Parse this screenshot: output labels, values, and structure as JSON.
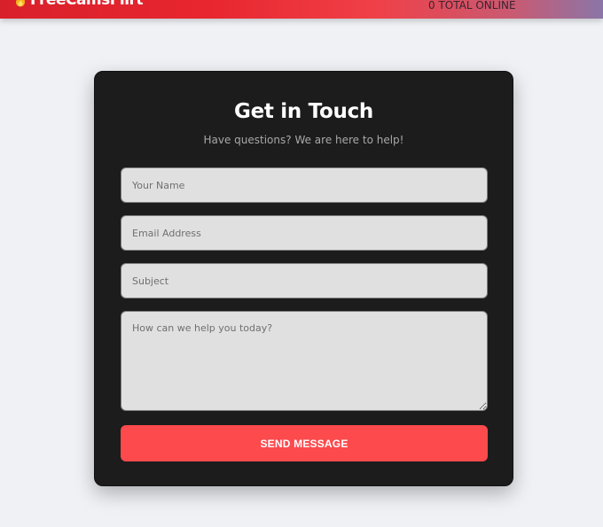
{
  "header": {
    "logo_text": "FreeCamsFlirt",
    "online_status": "0 TOTAL ONLINE",
    "logo_icon": "flame-icon"
  },
  "contact_form": {
    "title": "Get in Touch",
    "subtitle": "Have questions? We are here to help!",
    "name_placeholder": "Your Name",
    "name_value": "",
    "email_placeholder": "Email Address",
    "email_value": "",
    "subject_placeholder": "Subject",
    "subject_value": "",
    "message_placeholder": "How can we help you today?",
    "message_value": "",
    "submit_label": "SEND MESSAGE"
  },
  "colors": {
    "header_gradient_start": "#d8202b",
    "header_gradient_end": "#8a76a8",
    "card_background": "#1c1c1c",
    "input_background": "#e0e0e0",
    "button_background": "#fc4a4d",
    "page_background": "#eff1f5"
  }
}
